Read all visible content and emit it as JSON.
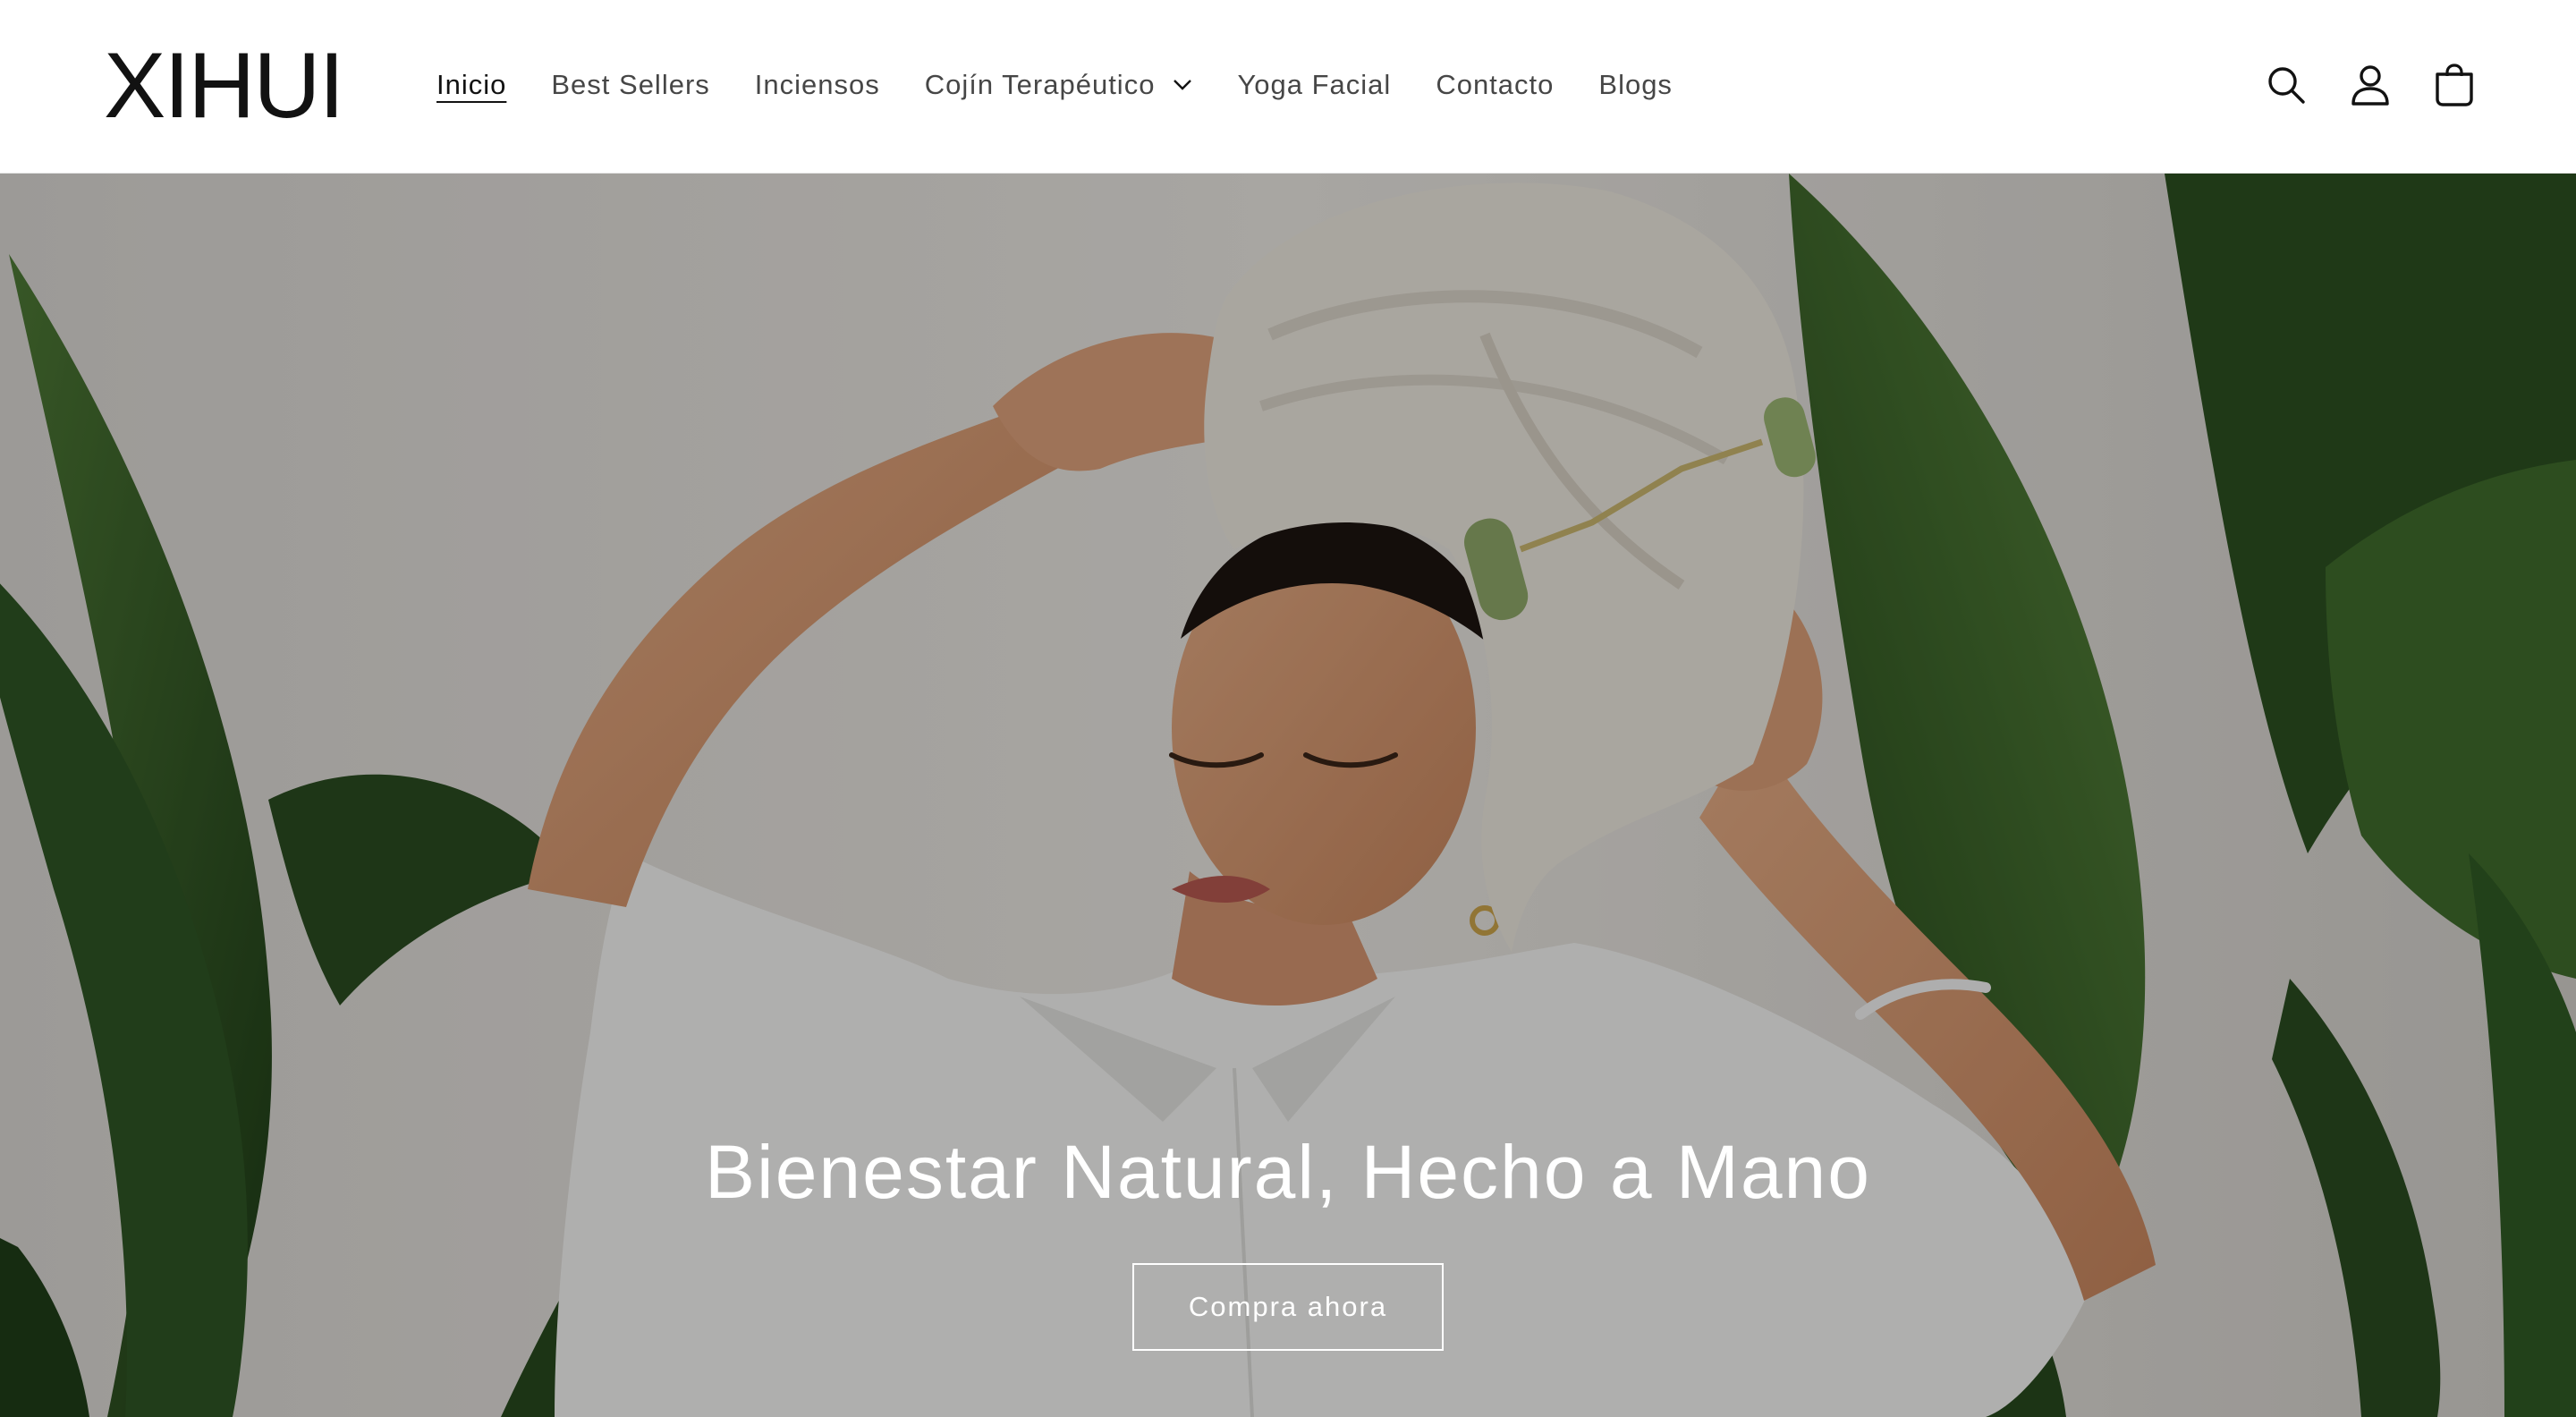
{
  "brand": {
    "logo_text": "XIHUI"
  },
  "nav": {
    "items": [
      {
        "label": "Inicio",
        "active": true
      },
      {
        "label": "Best Sellers",
        "active": false
      },
      {
        "label": "Inciensos",
        "active": false
      },
      {
        "label": "Cojín Terapéutico",
        "active": false,
        "has_dropdown": true
      },
      {
        "label": "Yoga Facial",
        "active": false
      },
      {
        "label": "Contacto",
        "active": false
      },
      {
        "label": "Blogs",
        "active": false
      }
    ]
  },
  "header_icons": [
    "search-icon",
    "account-icon",
    "cart-icon"
  ],
  "hero": {
    "heading": "Bienestar Natural, Hecho a Mano",
    "button_label": "Compra ahora",
    "image_subject": "woman with towel on head using jade face roller among tropical leaves"
  },
  "colors": {
    "text": "#121212",
    "background": "#ffffff",
    "hero_text": "#ffffff"
  }
}
